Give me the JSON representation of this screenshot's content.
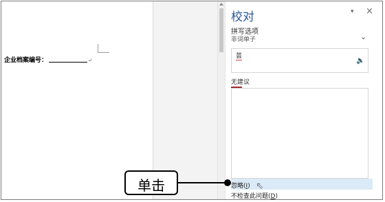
{
  "document": {
    "line_text": "企业档案编号：",
    "para_mark": "↵"
  },
  "pane": {
    "title": "校对",
    "dropdown_icon": "▾",
    "close_icon": "×",
    "section_label": "拼写选项",
    "section_value": "非词单子",
    "section_chevron": "⌄",
    "misspelled_word": "芸",
    "speaker_icon": "🔈",
    "no_suggestions_label": "无建议",
    "ignore_label": "忽略",
    "ignore_key": "I",
    "no_check_label": "不检查此问题",
    "no_check_key": "D",
    "accent_color": "#2b579a",
    "error_color": "#a4262c"
  },
  "callout": {
    "text": "单击"
  }
}
